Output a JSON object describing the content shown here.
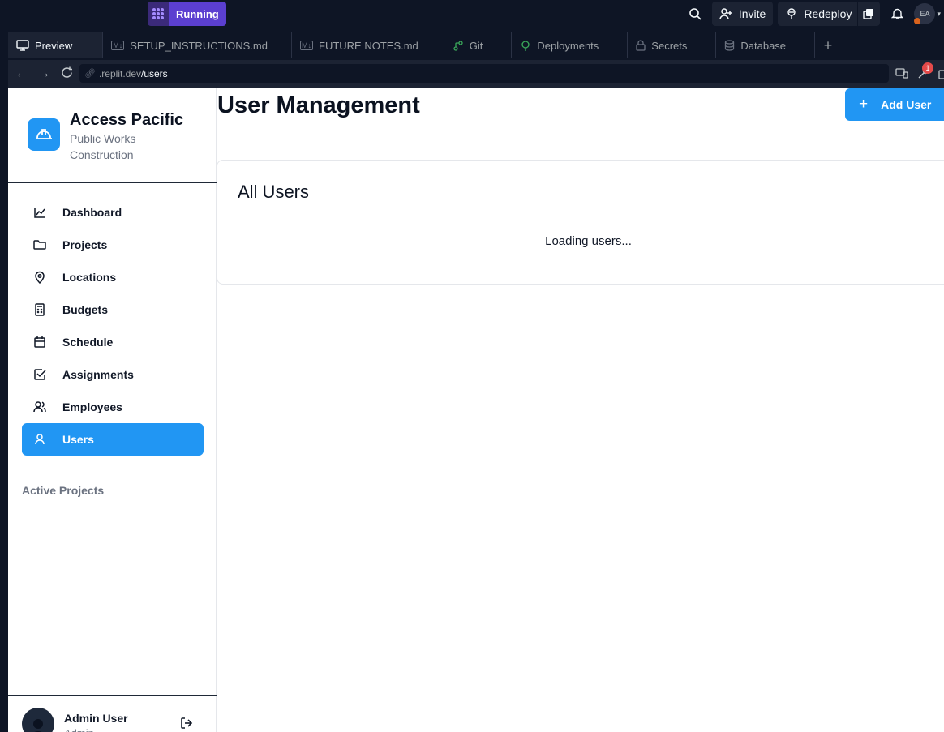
{
  "ide": {
    "run_status": "Running",
    "invite_label": "Invite",
    "redeploy_label": "Redeploy",
    "avatar_initials": "EA",
    "tabs": [
      {
        "label": "Preview",
        "icon": "monitor-icon",
        "active": true
      },
      {
        "label": "SETUP_INSTRUCTIONS.md",
        "icon": "markdown-icon",
        "active": false
      },
      {
        "label": "FUTURE NOTES.md",
        "icon": "markdown-icon",
        "active": false
      },
      {
        "label": "Git",
        "icon": "git-icon",
        "active": false
      },
      {
        "label": "Deployments",
        "icon": "deployments-icon",
        "active": false
      },
      {
        "label": "Secrets",
        "icon": "lock-icon",
        "active": false
      },
      {
        "label": "Database",
        "icon": "database-icon",
        "active": false
      }
    ],
    "url_domain": ".replit.dev",
    "url_path": "/users",
    "devtools_badge": "1"
  },
  "app": {
    "brand": {
      "name": "Access Pacific",
      "subtitle": "Public Works Construction"
    },
    "nav": [
      {
        "label": "Dashboard",
        "icon": "chart-line-icon",
        "active": false
      },
      {
        "label": "Projects",
        "icon": "folder-icon",
        "active": false
      },
      {
        "label": "Locations",
        "icon": "map-pin-icon",
        "active": false
      },
      {
        "label": "Budgets",
        "icon": "calculator-icon",
        "active": false
      },
      {
        "label": "Schedule",
        "icon": "calendar-icon",
        "active": false
      },
      {
        "label": "Assignments",
        "icon": "check-square-icon",
        "active": false
      },
      {
        "label": "Employees",
        "icon": "users-icon",
        "active": false
      },
      {
        "label": "Users",
        "icon": "user-icon",
        "active": true
      }
    ],
    "section_label": "Active Projects",
    "user": {
      "name": "Admin User",
      "role": "Admin"
    },
    "page_title": "User Management",
    "add_button_label": "Add User",
    "card": {
      "title": "All Users",
      "status": "Loading users..."
    },
    "colors": {
      "accent": "#2196f3",
      "run": "#5b3fd0",
      "ide_bg": "#0e1525"
    }
  }
}
